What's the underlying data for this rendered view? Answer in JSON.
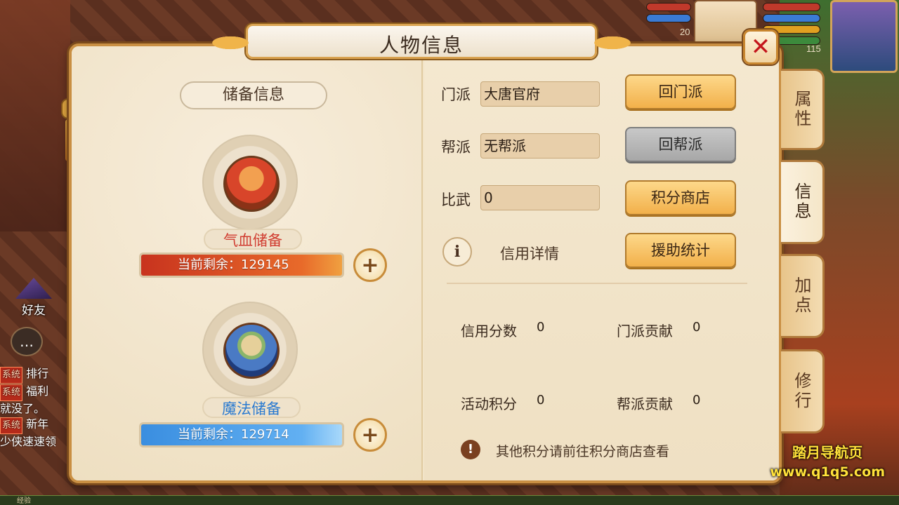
{
  "panel": {
    "title": "人物信息"
  },
  "left": {
    "section_title": "储备信息",
    "hp": {
      "label": "气血储备",
      "bar_text": "当前剩余：129145"
    },
    "mp": {
      "label": "魔法储备",
      "bar_text": "当前剩余：129714"
    }
  },
  "right": {
    "rows": [
      {
        "label": "门派",
        "value": "大唐官府",
        "button": "回门派",
        "button_enabled": true
      },
      {
        "label": "帮派",
        "value": "无帮派",
        "button": "回帮派",
        "button_enabled": false
      },
      {
        "label": "比武",
        "value": "0",
        "button": "积分商店",
        "button_enabled": true
      }
    ],
    "credit": {
      "label": "信用详情",
      "button": "援助统计"
    },
    "stats": [
      {
        "label": "信用分数",
        "value": "0"
      },
      {
        "label": "门派贡献",
        "value": "0"
      },
      {
        "label": "活动积分",
        "value": "0"
      },
      {
        "label": "帮派贡献",
        "value": "0"
      }
    ],
    "note": "其他积分请前往积分商店查看"
  },
  "tabs": [
    {
      "label": "属性",
      "active": false
    },
    {
      "label": "信息",
      "active": true
    },
    {
      "label": "加点",
      "active": false
    },
    {
      "label": "修行",
      "active": false
    }
  ],
  "hud": {
    "pet_level": "20",
    "player_level": "115"
  },
  "social": {
    "friend_label": "好友"
  },
  "chat": [
    {
      "tag": "系统",
      "text": "排行"
    },
    {
      "tag": "系统",
      "text": "福利"
    },
    {
      "tag": "",
      "text": "就没了。"
    },
    {
      "tag": "系统",
      "text": "新年"
    },
    {
      "tag": "",
      "text": "少侠速速领"
    }
  ],
  "watermark": {
    "line1": "踏月导航页",
    "line2": "www.q1q5.com"
  },
  "exp_label": "经验",
  "icons": {
    "close": "close-icon",
    "plus": "plus-icon",
    "info": "info-icon",
    "warning": "exclamation-icon",
    "chat": "chat-bubble-icon"
  }
}
